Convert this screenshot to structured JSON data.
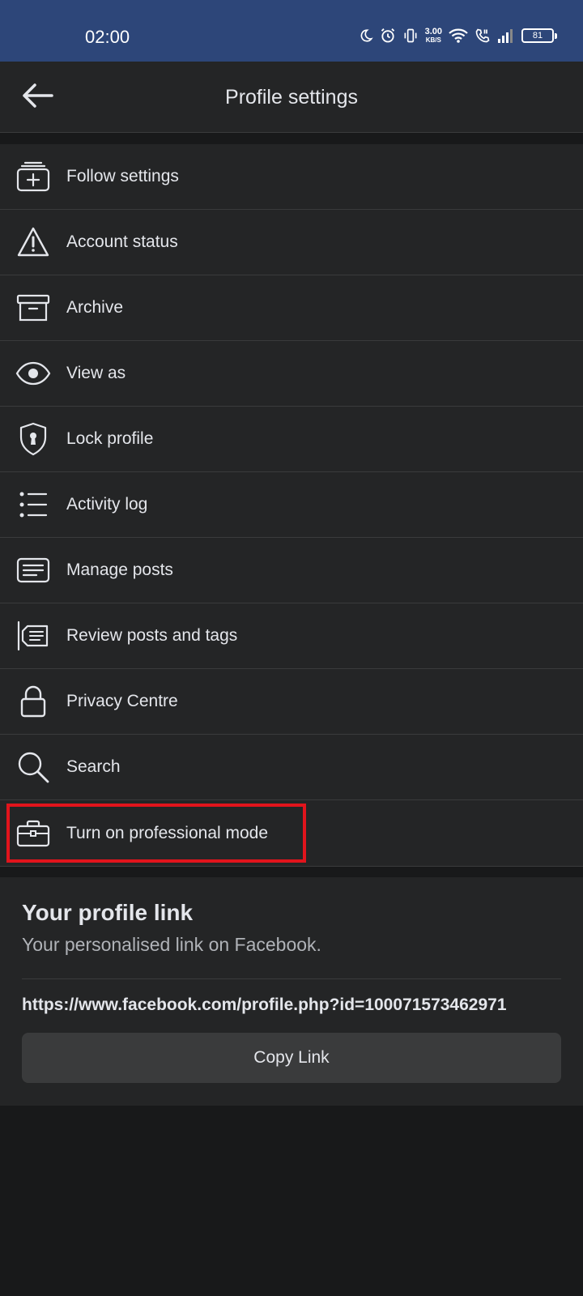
{
  "status_bar": {
    "time": "02:00",
    "speed_value": "3.00",
    "speed_unit": "KB/S",
    "battery": "81",
    "icons": [
      "moon-icon",
      "alarm-icon",
      "vibrate-icon",
      "wifi-icon",
      "volte-call-icon",
      "signal-icon",
      "battery-icon"
    ]
  },
  "header": {
    "title": "Profile settings",
    "back_icon": "back-arrow-icon"
  },
  "menu": {
    "items": [
      {
        "label": "Follow settings",
        "icon": "follow-settings-icon"
      },
      {
        "label": "Account status",
        "icon": "warning-icon"
      },
      {
        "label": "Archive",
        "icon": "archive-icon"
      },
      {
        "label": "View as",
        "icon": "eye-icon"
      },
      {
        "label": "Lock profile",
        "icon": "shield-lock-icon"
      },
      {
        "label": "Activity log",
        "icon": "list-icon"
      },
      {
        "label": "Manage posts",
        "icon": "posts-icon"
      },
      {
        "label": "Review posts and tags",
        "icon": "review-tags-icon"
      },
      {
        "label": "Privacy Centre",
        "icon": "lock-icon"
      },
      {
        "label": "Search",
        "icon": "search-icon"
      },
      {
        "label": "Turn on professional mode",
        "icon": "briefcase-icon",
        "highlighted": true
      }
    ]
  },
  "profile_link": {
    "title": "Your profile link",
    "subtitle": "Your personalised link on Facebook.",
    "url": "https://www.facebook.com/profile.php?id=100071573462971",
    "copy_label": "Copy Link"
  },
  "colors": {
    "status_bar": "#2d4679",
    "surface": "#242526",
    "background": "#18191a",
    "highlight": "#e1141c",
    "text": "#e4e6eb",
    "secondary_text": "#b0b3b8"
  }
}
